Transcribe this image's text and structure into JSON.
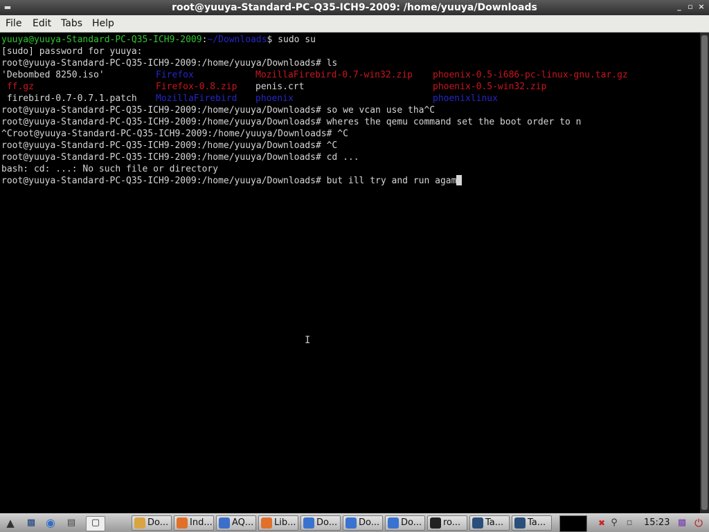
{
  "window": {
    "title": "root@yuuya-Standard-PC-Q35-ICH9-2009: /home/yuuya/Downloads",
    "menu_icon": "window-menu-icon",
    "controls": [
      "minimize-icon",
      "maximize-icon",
      "close-icon"
    ]
  },
  "menubar": {
    "items": [
      "File",
      "Edit",
      "Tabs",
      "Help"
    ]
  },
  "terminal": {
    "prompt1_user": "yuuya@yuuya-Standard-PC-Q35-ICH9-2009",
    "prompt1_sep": ":",
    "prompt1_path": "~/Downloads",
    "prompt1_cmd": "$ sudo su",
    "line2": "[sudo] password for yuuya:",
    "line3": "root@yuuya-Standard-PC-Q35-ICH9-2009:/home/yuuya/Downloads# ls",
    "ls_rows": [
      [
        {
          "text": "'Debombed 8250.iso'",
          "color": "white"
        },
        {
          "text": "Firefox",
          "color": "blue"
        },
        {
          "text": "MozillaFirebird-0.7-win32.zip",
          "color": "red"
        },
        {
          "text": "phoenix-0.5-i686-pc-linux-gnu.tar.gz",
          "color": "red"
        }
      ],
      [
        {
          "text": " ff.gz",
          "color": "red"
        },
        {
          "text": "Firefox-0.8.zip",
          "color": "red"
        },
        {
          "text": "penis.crt",
          "color": "white"
        },
        {
          "text": "phoenix-0.5-win32.zip",
          "color": "red"
        }
      ],
      [
        {
          "text": " firebird-0.7-0.7.1.patch",
          "color": "white"
        },
        {
          "text": "MozillaFirebird",
          "color": "blue"
        },
        {
          "text": "phoenix",
          "color": "blue"
        },
        {
          "text": "phoenixlinux",
          "color": "blue"
        }
      ]
    ],
    "lines_after": [
      "root@yuuya-Standard-PC-Q35-ICH9-2009:/home/yuuya/Downloads# so we vcan use tha^C",
      "root@yuuya-Standard-PC-Q35-ICH9-2009:/home/yuuya/Downloads# wheres the qemu command set the boot order to n",
      "^Croot@yuuya-Standard-PC-Q35-ICH9-2009:/home/yuuya/Downloads# ^C",
      "root@yuuya-Standard-PC-Q35-ICH9-2009:/home/yuuya/Downloads# ^C",
      "root@yuuya-Standard-PC-Q35-ICH9-2009:/home/yuuya/Downloads# cd ...",
      "bash: cd: ...: No such file or directory"
    ],
    "current_line": "root@yuuya-Standard-PC-Q35-ICH9-2009:/home/yuuya/Downloads# but ill try and run agam",
    "colors": {
      "user_green": "#2fc62f",
      "dir_blue": "#2626c8",
      "archive_red": "#c8161e",
      "fg": "#d6d6d6",
      "bg": "#000000"
    }
  },
  "taskbar": {
    "launchers": [
      "start-menu-icon",
      "show-desktop-icon",
      "network-globe-icon",
      "file-manager-icon",
      "terminal-launcher-icon"
    ],
    "tasks": [
      {
        "label": "Do...",
        "icon": "folder-icon",
        "color": "#d9a441"
      },
      {
        "label": "Ind...",
        "icon": "firefox-icon",
        "color": "#e0702a"
      },
      {
        "label": "AQ...",
        "icon": "browser-icon",
        "color": "#3b6fc9"
      },
      {
        "label": "Lib...",
        "icon": "firefox-icon",
        "color": "#e0702a"
      },
      {
        "label": "Do...",
        "icon": "document-icon",
        "color": "#3a72d0"
      },
      {
        "label": "Do...",
        "icon": "document-icon",
        "color": "#3a72d0"
      },
      {
        "label": "Do...",
        "icon": "document-icon",
        "color": "#3a72d0"
      },
      {
        "label": "ro...",
        "icon": "terminal-icon",
        "color": "#222222"
      },
      {
        "label": "Ta...",
        "icon": "task-manager-icon",
        "color": "#2a4f7a"
      },
      {
        "label": "Ta...",
        "icon": "task-manager-icon",
        "color": "#2a4f7a"
      }
    ],
    "clock": "15:23"
  }
}
